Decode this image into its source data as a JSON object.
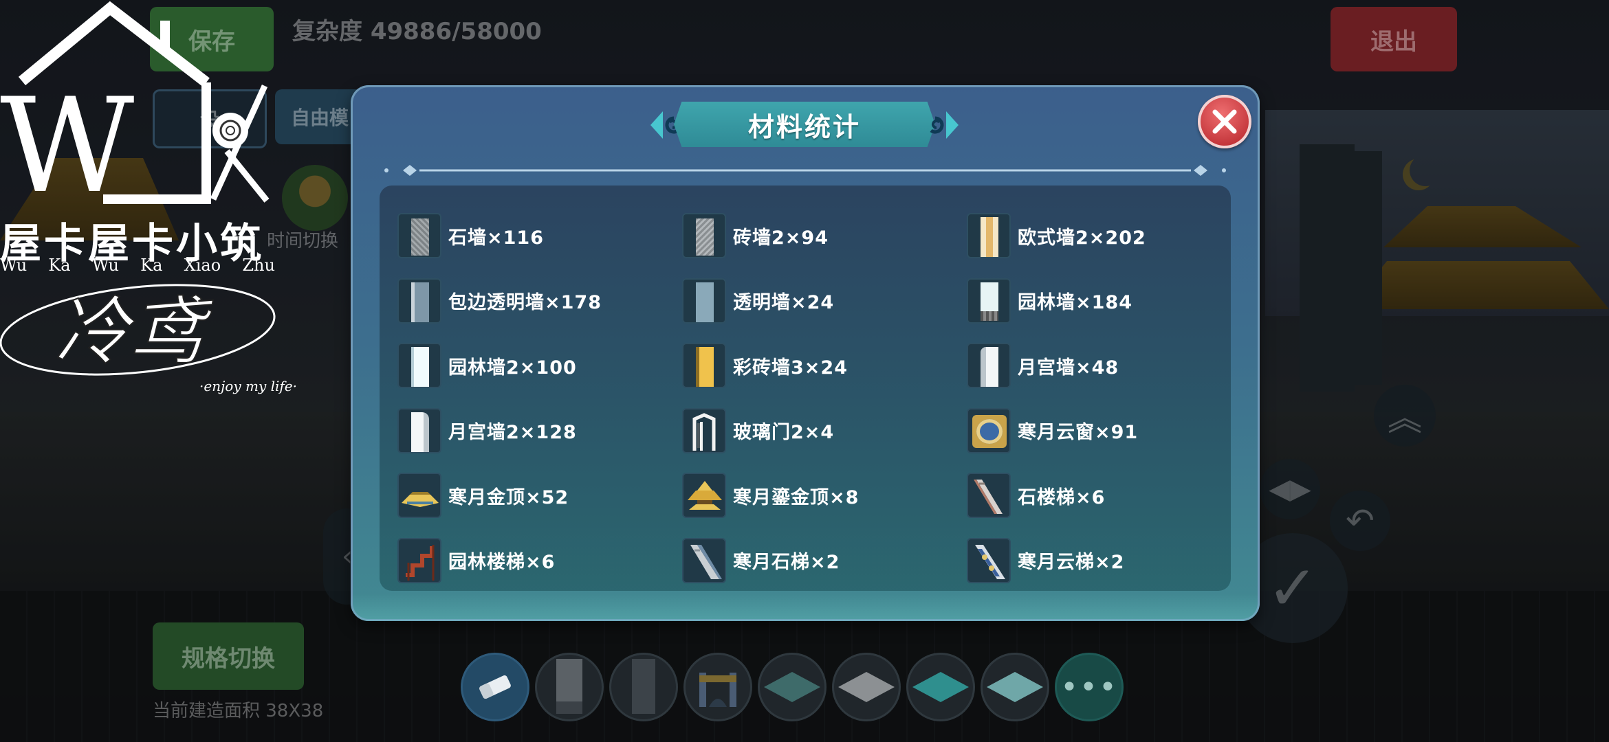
{
  "hud": {
    "save_label": "保存",
    "exit_label": "退出",
    "complexity": "复杂度 49886/58000",
    "settings_label": "设",
    "mode_label": "自由模",
    "time_switch": "时间切换",
    "spec_switch": "规格切换",
    "build_area": "当前建造面积 38X38"
  },
  "watermark": {
    "title": "屋卡屋卡小筑",
    "pinyin": [
      "Wu",
      "Ka",
      "Wu",
      "Ka",
      "Xiao",
      "Zhu"
    ],
    "signature": "冷鸢",
    "tagline": "·enjoy my life·",
    "letter": "W"
  },
  "dialog": {
    "title": "材料统计",
    "items": [
      {
        "name": "石墙",
        "count": "×116",
        "label": "石墙×116",
        "icon": "stone-wall-icon"
      },
      {
        "name": "砖墙2",
        "count": "×94",
        "label": "砖墙2×94",
        "icon": "brick-wall-icon"
      },
      {
        "name": "欧式墙2",
        "count": "×202",
        "label": "欧式墙2×202",
        "icon": "european-wall-icon"
      },
      {
        "name": "包边透明墙",
        "count": "×178",
        "label": "包边透明墙×178",
        "icon": "framed-glass-wall-icon"
      },
      {
        "name": "透明墙",
        "count": "×24",
        "label": "透明墙×24",
        "icon": "glass-wall-icon"
      },
      {
        "name": "园林墙",
        "count": "×184",
        "label": "园林墙×184",
        "icon": "garden-wall-icon"
      },
      {
        "name": "园林墙2",
        "count": "×100",
        "label": "园林墙2×100",
        "icon": "garden-wall-2-icon"
      },
      {
        "name": "彩砖墙3",
        "count": "×24",
        "label": "彩砖墙3×24",
        "icon": "color-brick-wall-icon"
      },
      {
        "name": "月宫墙",
        "count": "×48",
        "label": "月宫墙×48",
        "icon": "moon-palace-wall-icon"
      },
      {
        "name": "月宫墙2",
        "count": "×128",
        "label": "月宫墙2×128",
        "icon": "moon-palace-wall-2-icon"
      },
      {
        "name": "玻璃门2",
        "count": "×4",
        "label": "玻璃门2×4",
        "icon": "glass-door-icon"
      },
      {
        "name": "寒月云窗",
        "count": "×91",
        "label": "寒月云窗×91",
        "icon": "cloud-window-icon"
      },
      {
        "name": "寒月金顶",
        "count": "×52",
        "label": "寒月金顶×52",
        "icon": "golden-roof-icon"
      },
      {
        "name": "寒月鎏金顶",
        "count": "×8",
        "label": "寒月鎏金顶×8",
        "icon": "gilded-roof-icon"
      },
      {
        "name": "石楼梯",
        "count": "×6",
        "label": "石楼梯×6",
        "icon": "stone-stairs-icon"
      },
      {
        "name": "园林楼梯",
        "count": "×6",
        "label": "园林楼梯×6",
        "icon": "garden-stairs-icon"
      },
      {
        "name": "寒月石梯",
        "count": "×2",
        "label": "寒月石梯×2",
        "icon": "stone-ladder-icon"
      },
      {
        "name": "寒月云梯",
        "count": "×2",
        "label": "寒月云梯×2",
        "icon": "cloud-ladder-icon"
      }
    ]
  },
  "toolbar": {
    "tools": [
      "eraser-icon",
      "dark-wall-icon",
      "dark-panel-icon",
      "fence-icon",
      "teal-tile-icon",
      "gray-tile-icon",
      "cyan-tile-icon",
      "light-tile-icon"
    ],
    "more_label": "•••"
  },
  "colors": {
    "dialog_top": "#3c5f8c",
    "dialog_bottom": "#428a92",
    "title_plate": "#3fa5ad",
    "close_red": "#d9454a",
    "accent_teal": "#48c6cf"
  }
}
